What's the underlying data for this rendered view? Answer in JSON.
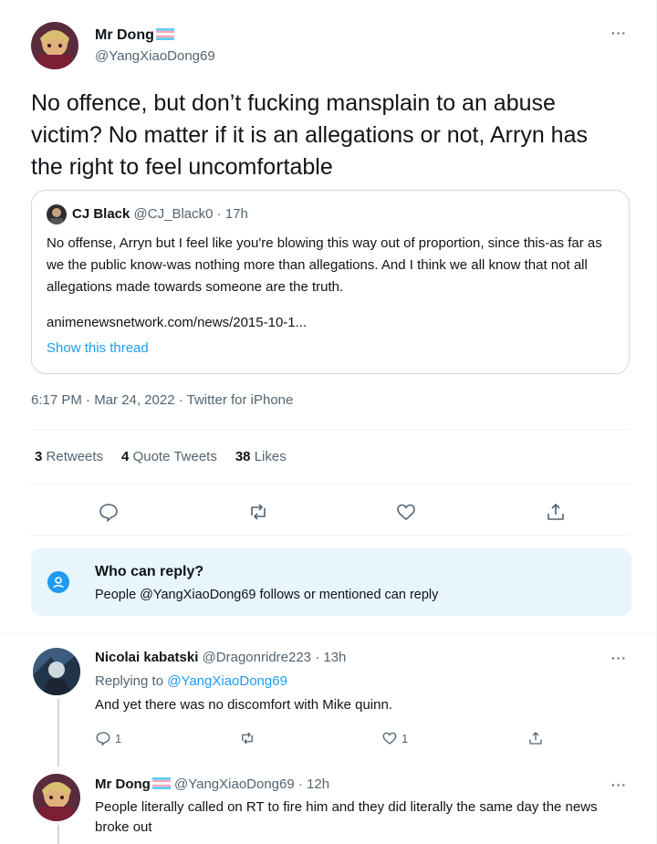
{
  "main_tweet": {
    "display_name": "Mr Dong",
    "handle": "@YangXiaoDong69",
    "more": "···",
    "text": "No offence, but don’t fucking mansplain to an abuse victim? No matter if it is an  allegations or not, Arryn has the right to feel uncomfortable",
    "quoted": {
      "display_name": "CJ Black",
      "handle": "@CJ_Black0",
      "time": "· 17h",
      "text": "No offense, Arryn but I feel like you're blowing this way out of proportion, since this-as far as we the public know-was nothing more than allegations. And I think we all know that not all allegations made towards someone are the truth.",
      "link": "animenewsnetwork.com/news/2015-10-1...",
      "show_thread": "Show this thread"
    },
    "timestamp": "6:17 PM · Mar 24, 2022 · Twitter for iPhone",
    "stats": {
      "retweets_count": "3",
      "retweets_label": "Retweets",
      "quotes_count": "4",
      "quotes_label": "Quote Tweets",
      "likes_count": "38",
      "likes_label": "Likes"
    },
    "who_can_reply": {
      "title": "Who can reply?",
      "subtitle": "People @YangXiaoDong69 follows or mentioned can reply"
    }
  },
  "replies": [
    {
      "display_name": "Nicolai kabatski",
      "handle": "@Dragonridre223",
      "time": "· 13h",
      "replying_prefix": "Replying to",
      "replying_to": "@YangXiaoDong69",
      "text": "And yet there  was no discomfort with Mike quinn.",
      "reply_count": "1",
      "like_count": "1"
    },
    {
      "display_name": "Mr Dong",
      "handle": "@YangXiaoDong69",
      "time": "· 12h",
      "text": "People literally called on RT to fire him and they did literally the same day the news broke out"
    }
  ],
  "colors": {
    "accent": "#1d9bf0",
    "text": "#0f1419",
    "muted": "#536471",
    "who_bg": "#e8f5fd"
  }
}
